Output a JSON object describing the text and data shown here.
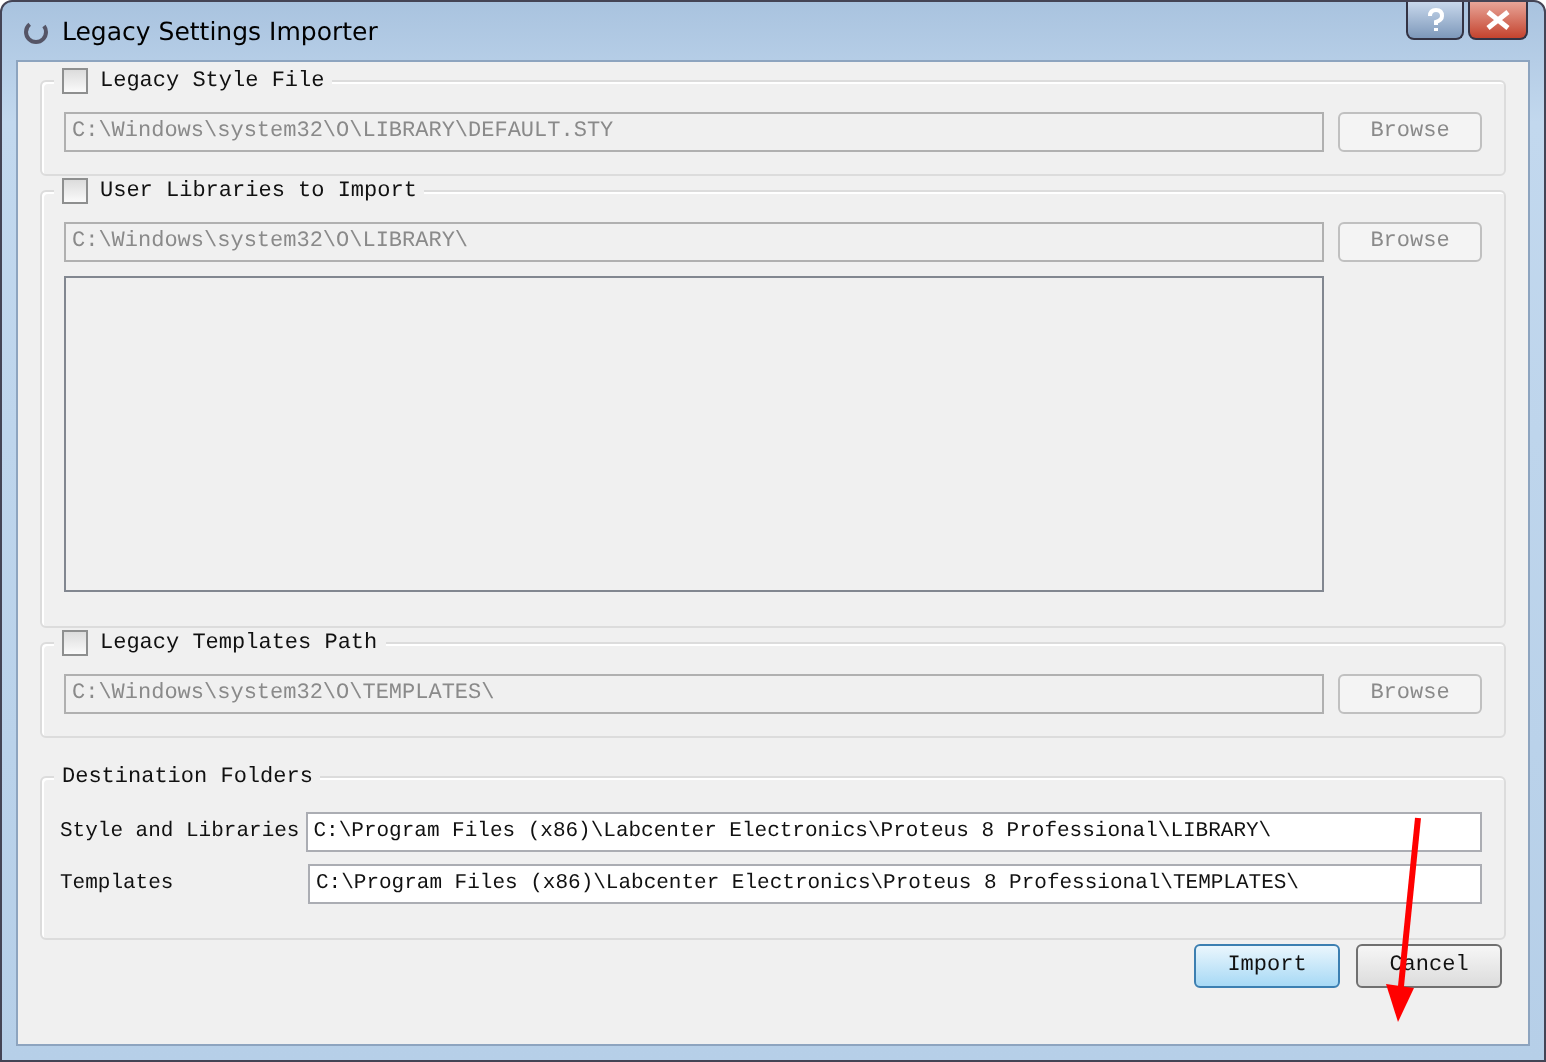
{
  "window": {
    "title": "Legacy Settings Importer"
  },
  "groups": [
    {
      "kind": "path",
      "label": "Legacy Style File",
      "checked": false,
      "path": "C:\\Windows\\system32\\O\\LIBRARY\\DEFAULT.STY",
      "browse": "Browse"
    },
    {
      "kind": "list",
      "label": "User Libraries to Import",
      "checked": false,
      "path": "C:\\Windows\\system32\\O\\LIBRARY\\",
      "browse": "Browse"
    },
    {
      "kind": "path",
      "label": "Legacy Templates Path",
      "checked": false,
      "path": "C:\\Windows\\system32\\O\\TEMPLATES\\",
      "browse": "Browse"
    }
  ],
  "destination": {
    "title": "Destination Folders",
    "rows": [
      {
        "label": "Style and Libraries",
        "value": "C:\\Program Files (x86)\\Labcenter Electronics\\Proteus 8 Professional\\LIBRARY\\"
      },
      {
        "label": "Templates",
        "value": "C:\\Program Files (x86)\\Labcenter Electronics\\Proteus 8 Professional\\TEMPLATES\\"
      }
    ]
  },
  "buttons": [
    {
      "label": "Import",
      "default": true
    },
    {
      "label": "Cancel",
      "default": false
    }
  ]
}
